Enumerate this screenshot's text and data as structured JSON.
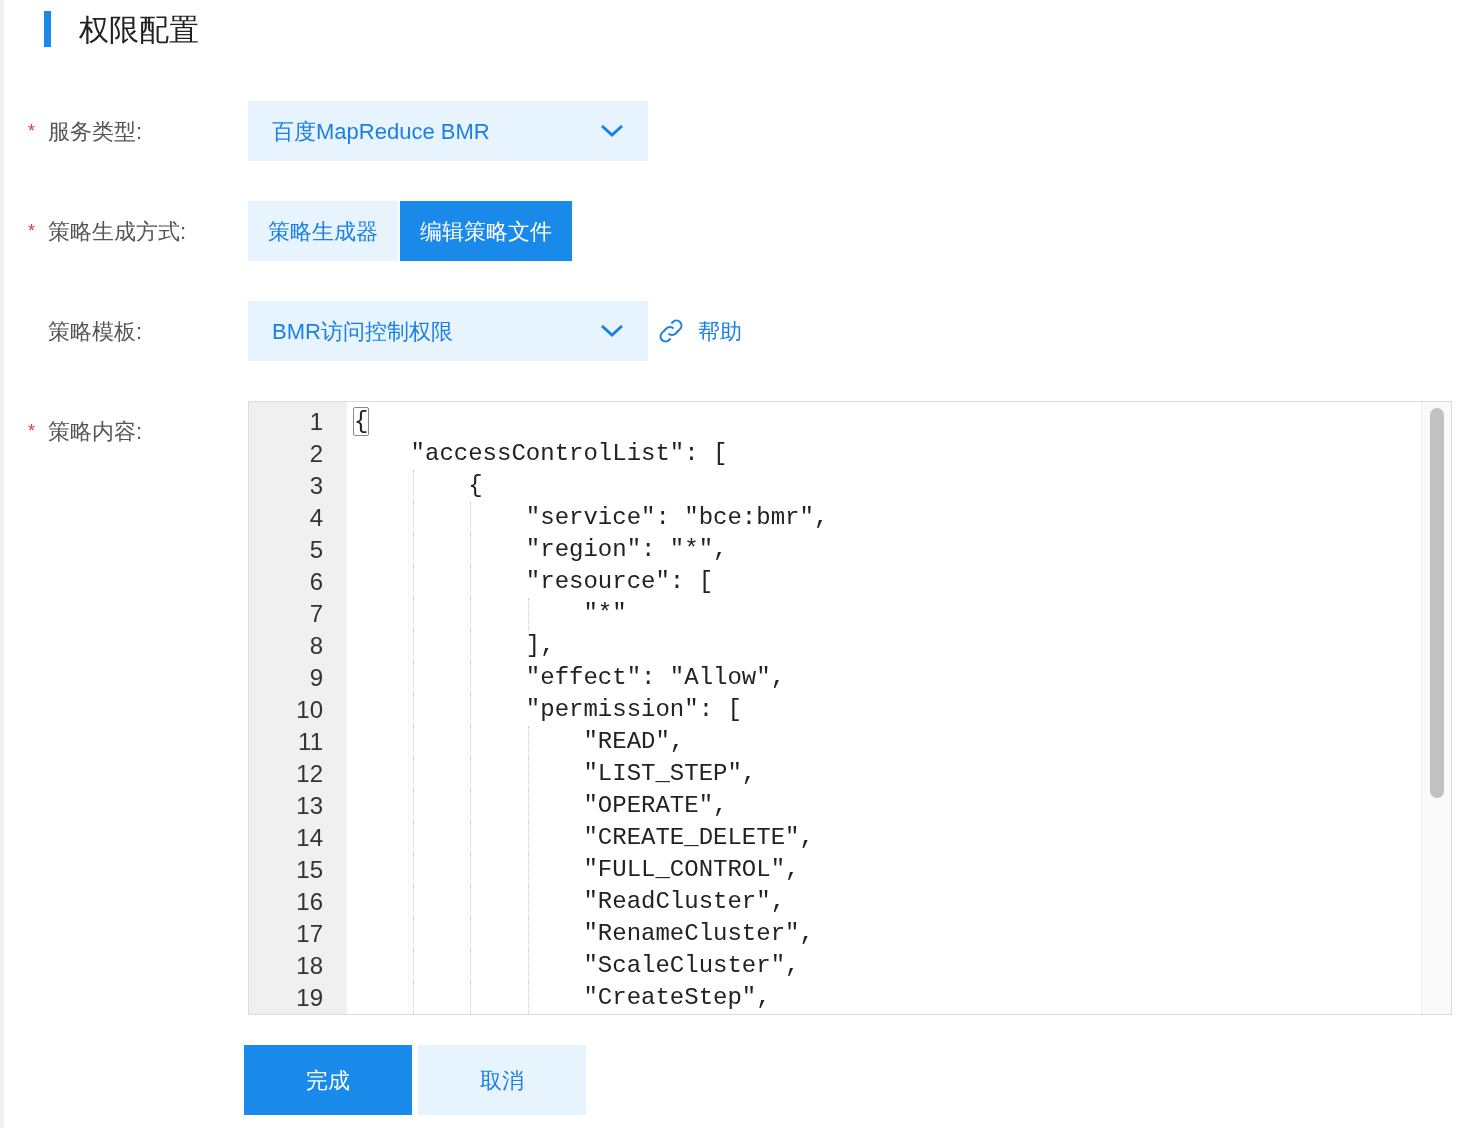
{
  "title": "权限配置",
  "form": [
    {
      "kind": "select",
      "required_mark": "*",
      "label": "服务类型:",
      "value": "百度MapReduce BMR"
    },
    {
      "kind": "segmented",
      "required_mark": "*",
      "label": "策略生成方式:",
      "options": [
        {
          "label": "策略生成器",
          "selected": false
        },
        {
          "label": "编辑策略文件",
          "selected": true
        }
      ]
    },
    {
      "kind": "select",
      "label": "策略模板:",
      "value": "BMR访问控制权限",
      "help": "帮助"
    },
    {
      "kind": "editor",
      "required_mark": "*",
      "label": "策略内容:"
    }
  ],
  "editor": {
    "lines": [
      {
        "number": "1",
        "text": "{",
        "highlight": true
      },
      {
        "number": "2",
        "text": "    \"accessControlList\": [",
        "highlight": false
      },
      {
        "number": "3",
        "text": "        {",
        "highlight": false
      },
      {
        "number": "4",
        "text": "            \"service\": \"bce:bmr\",",
        "highlight": false
      },
      {
        "number": "5",
        "text": "            \"region\": \"*\",",
        "highlight": false
      },
      {
        "number": "6",
        "text": "            \"resource\": [",
        "highlight": false
      },
      {
        "number": "7",
        "text": "                \"*\"",
        "highlight": false
      },
      {
        "number": "8",
        "text": "            ],",
        "highlight": false
      },
      {
        "number": "9",
        "text": "            \"effect\": \"Allow\",",
        "highlight": false
      },
      {
        "number": "10",
        "text": "            \"permission\": [",
        "highlight": false
      },
      {
        "number": "11",
        "text": "                \"READ\",",
        "highlight": false
      },
      {
        "number": "12",
        "text": "                \"LIST_STEP\",",
        "highlight": false
      },
      {
        "number": "13",
        "text": "                \"OPERATE\",",
        "highlight": false
      },
      {
        "number": "14",
        "text": "                \"CREATE_DELETE\",",
        "highlight": false
      },
      {
        "number": "15",
        "text": "                \"FULL_CONTROL\",",
        "highlight": false
      },
      {
        "number": "16",
        "text": "                \"ReadCluster\",",
        "highlight": false
      },
      {
        "number": "17",
        "text": "                \"RenameCluster\",",
        "highlight": false
      },
      {
        "number": "18",
        "text": "                \"ScaleCluster\",",
        "highlight": false
      },
      {
        "number": "19",
        "text": "                \"CreateStep\",",
        "highlight": false
      }
    ]
  },
  "actions": [
    {
      "label": "完成",
      "primary": true
    },
    {
      "label": "取消",
      "primary": false
    }
  ]
}
